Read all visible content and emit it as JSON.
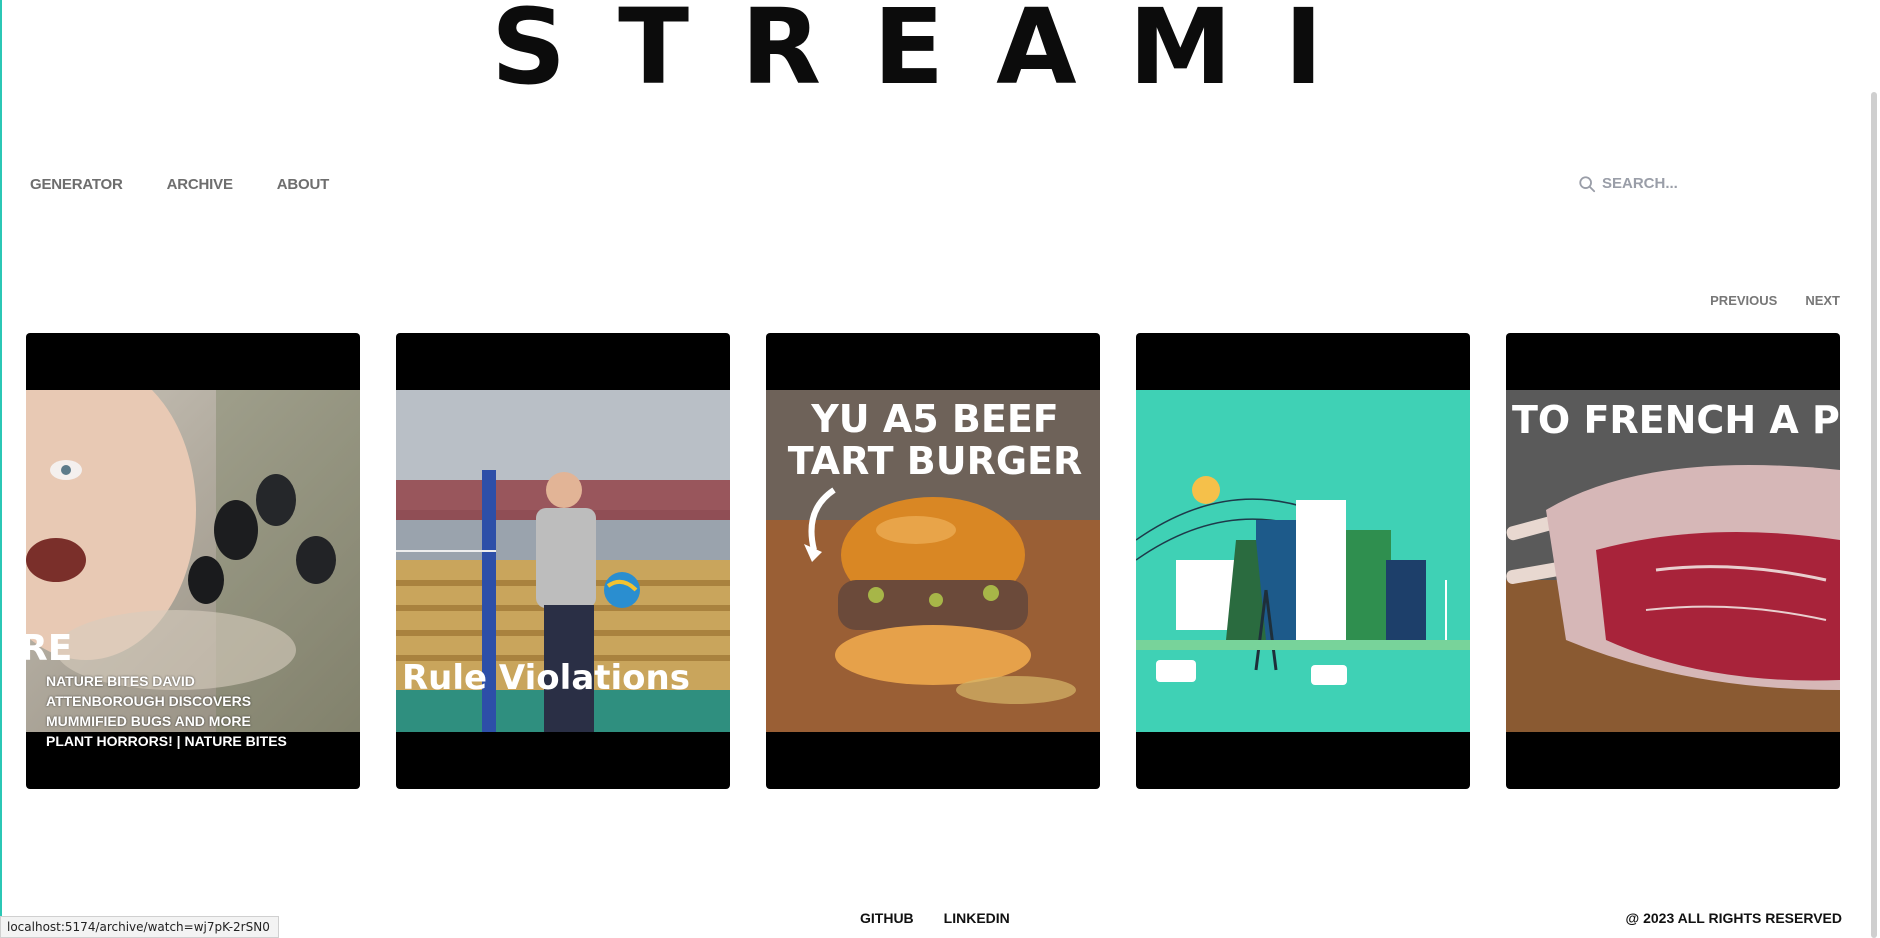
{
  "brand": {
    "logo": "STREAMI"
  },
  "nav": {
    "items": [
      "GENERATOR",
      "ARCHIVE",
      "ABOUT"
    ]
  },
  "search": {
    "placeholder": "SEARCH...",
    "icon": "search-icon"
  },
  "pager": {
    "previous": "PREVIOUS",
    "next": "NEXT"
  },
  "cards": [
    {
      "title": "NATURE BITES DAVID ATTENBOROUGH DISCOVERS MUMMIFIED BUGS AND MORE PLANT HORRORS! | NATURE BITES",
      "overlay_text": "RE",
      "subject": "david-attenborough-bugs"
    },
    {
      "title": "",
      "overlay_text": "Rule Violations",
      "subject": "volleyball-referee"
    },
    {
      "title": "",
      "overlay_text": "YU A5 BEEF TART BURGER",
      "subject": "beef-burger"
    },
    {
      "title": "",
      "overlay_text": "",
      "subject": "green-city-illustration"
    },
    {
      "title": "",
      "overlay_text": "TO FRENCH A PRIM",
      "subject": "prime-rib-roast"
    }
  ],
  "footer": {
    "links": [
      "GITHUB",
      "LINKEDIN"
    ],
    "copyright": "@ 2023 ALL RIGHTS RESERVED"
  },
  "status_bar": {
    "url": "localhost:5174/archive/watch=wj7pK-2rSN0"
  },
  "colors": {
    "accent": "#2bc7b5",
    "text": "#111111",
    "nav_text": "#6e6e6e"
  }
}
